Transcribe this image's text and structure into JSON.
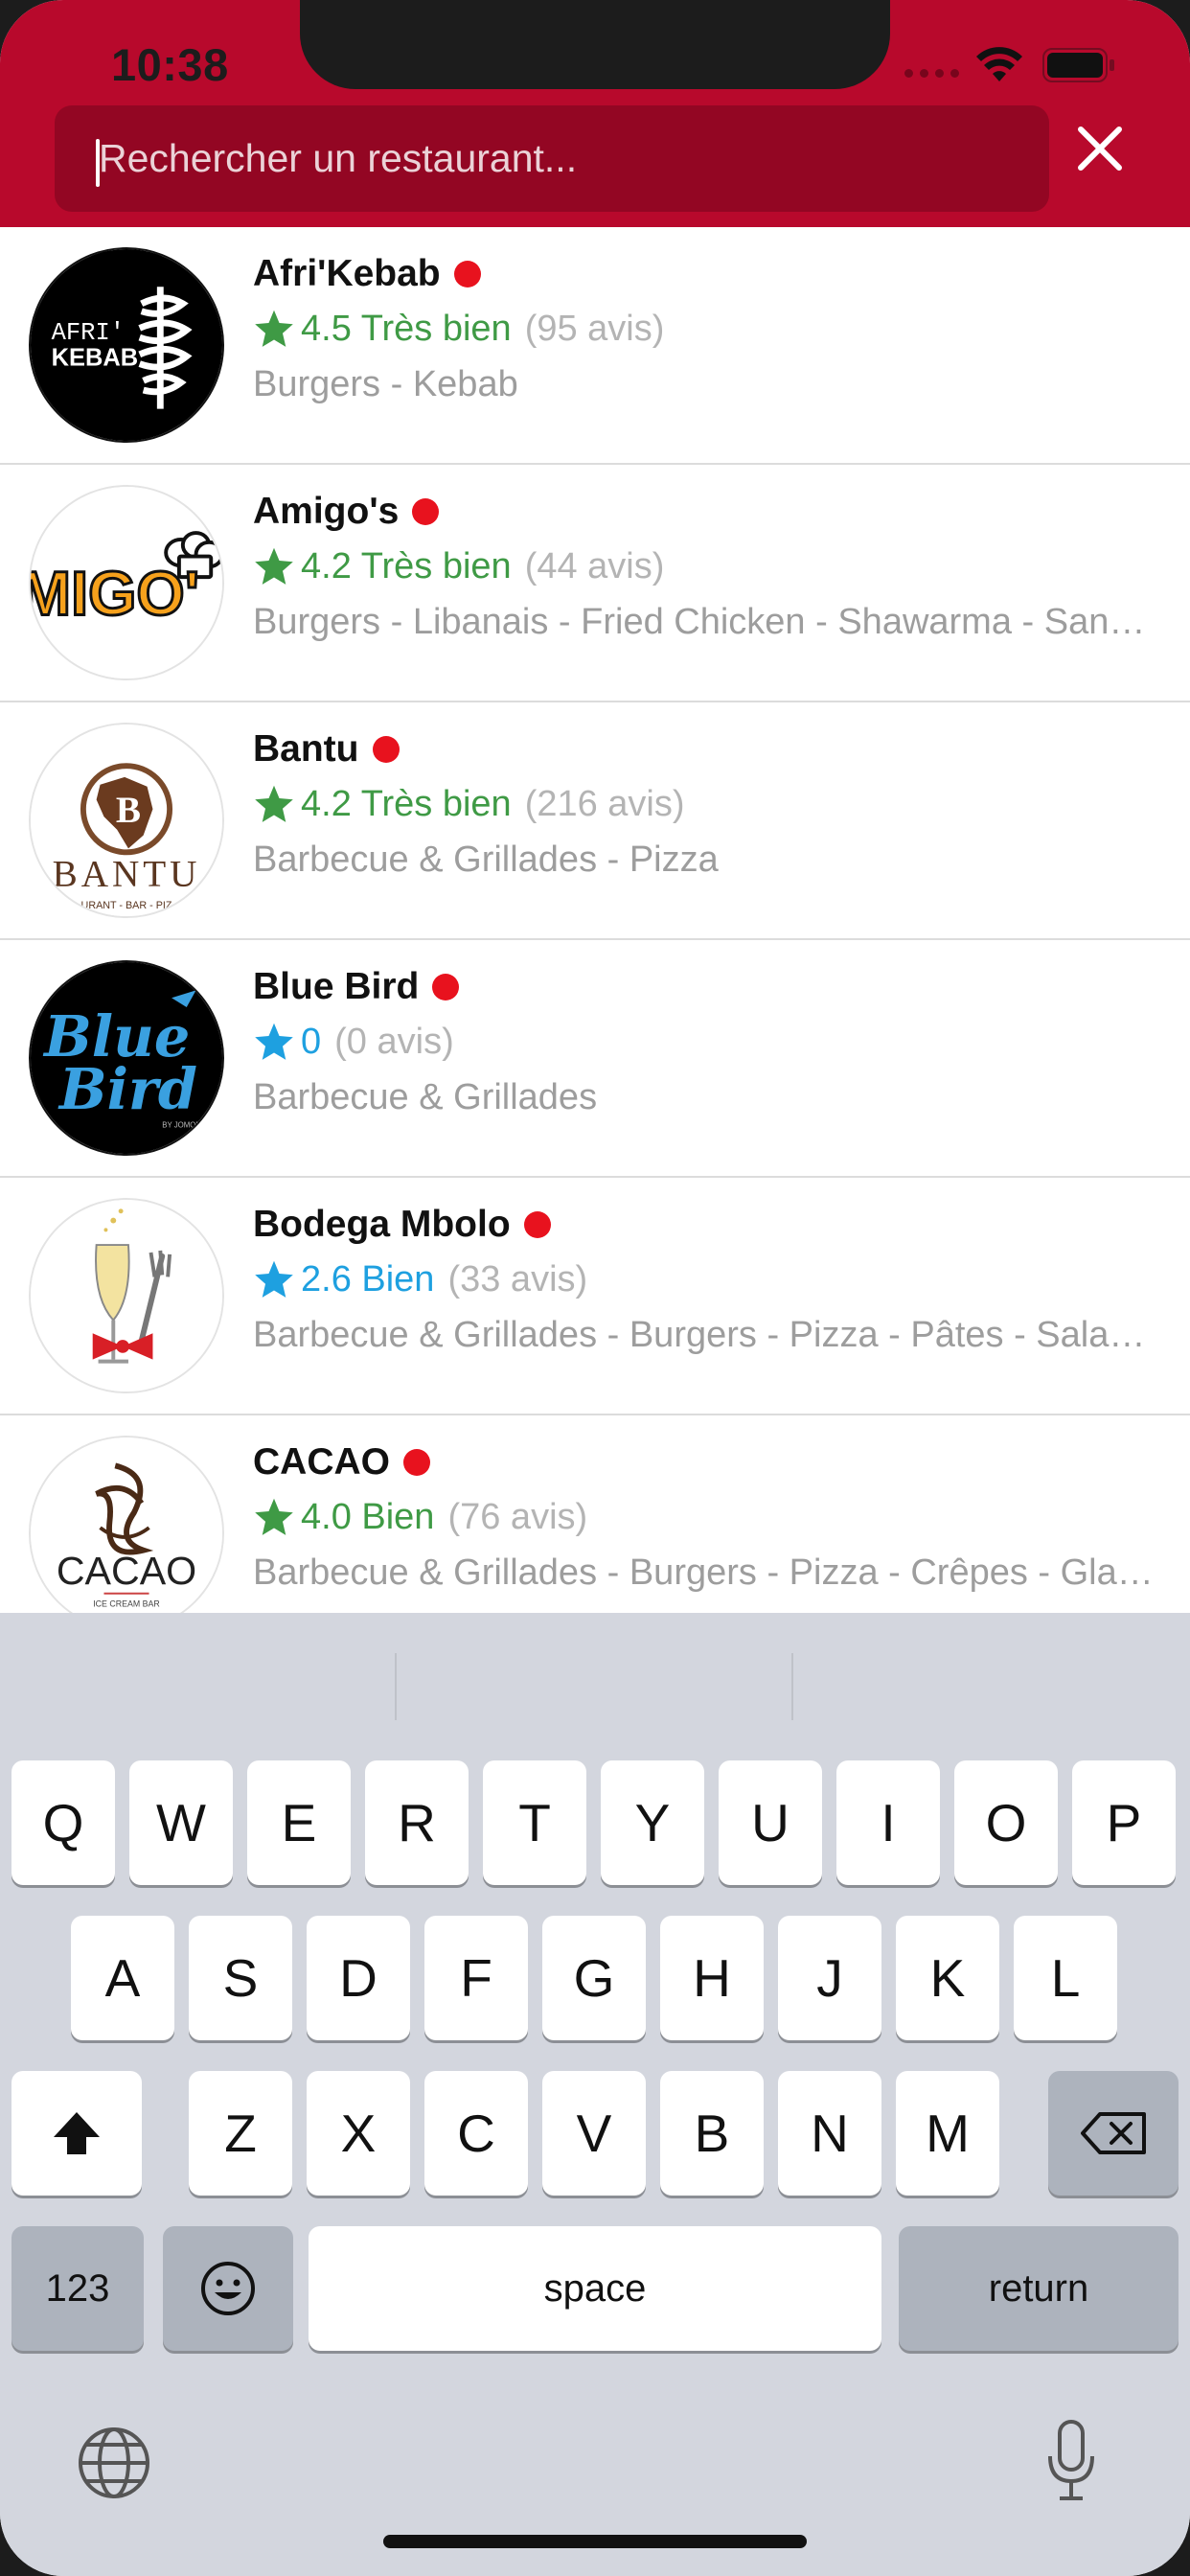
{
  "status_bar": {
    "time": "10:38"
  },
  "search": {
    "placeholder": "Rechercher un restaurant...",
    "value": ""
  },
  "colors": {
    "brand": "#b8092c",
    "search_bg": "#930623",
    "rating_green": "#3f9a45",
    "rating_blue": "#1ea0e0",
    "status_dot": "#e8121e"
  },
  "restaurants": [
    {
      "name": "Afri'Kebab",
      "rating": "4.5 Très bien",
      "reviews": "(95 avis)",
      "cuisines": "Burgers - Kebab",
      "rating_color": "#3f9a45",
      "logo": "afrikebab-logo"
    },
    {
      "name": "Amigo's",
      "rating": "4.2 Très bien",
      "reviews": "(44 avis)",
      "cuisines": "Burgers - Libanais - Fried Chicken - Shawarma - Sandwichs",
      "rating_color": "#3f9a45",
      "logo": "amigos-logo"
    },
    {
      "name": "Bantu",
      "rating": "4.2 Très bien",
      "reviews": "(216 avis)",
      "cuisines": "Barbecue & Grillades - Pizza",
      "rating_color": "#3f9a45",
      "logo": "bantu-logo"
    },
    {
      "name": "Blue Bird",
      "rating": "0",
      "reviews": "(0 avis)",
      "cuisines": "Barbecue & Grillades",
      "rating_color": "#1ea0e0",
      "logo": "bluebird-logo"
    },
    {
      "name": "Bodega Mbolo",
      "rating": "2.6 Bien",
      "reviews": "(33 avis)",
      "cuisines": "Barbecue & Grillades - Burgers - Pizza - Pâtes - Salades",
      "rating_color": "#1ea0e0",
      "logo": "bodega-logo"
    },
    {
      "name": "CACAO",
      "rating": "4.0 Bien",
      "reviews": "(76 avis)",
      "cuisines": "Barbecue & Grillades - Burgers - Pizza - Crêpes - Glaces",
      "rating_color": "#3f9a45",
      "logo": "cacao-logo"
    }
  ],
  "logos": {
    "afrikebab": {
      "line1": "AFRI'",
      "line2": "KEBAB"
    },
    "amigos": {
      "text": "MIGO'"
    },
    "bantu": {
      "text": "BANTU",
      "subtext": "URANT - BAR - PIZ"
    },
    "bluebird": {
      "line1": "Blue",
      "line2": "Bird",
      "subtext": "BY JOMONA"
    },
    "cacao": {
      "text": "CACAO",
      "subtext": "ICE CREAM BAR"
    }
  },
  "keyboard": {
    "row1": [
      "Q",
      "W",
      "E",
      "R",
      "T",
      "Y",
      "U",
      "I",
      "O",
      "P"
    ],
    "row2": [
      "A",
      "S",
      "D",
      "F",
      "G",
      "H",
      "J",
      "K",
      "L"
    ],
    "row3": [
      "Z",
      "X",
      "C",
      "V",
      "B",
      "N",
      "M"
    ],
    "numbers_label": "123",
    "space_label": "space",
    "return_label": "return"
  }
}
